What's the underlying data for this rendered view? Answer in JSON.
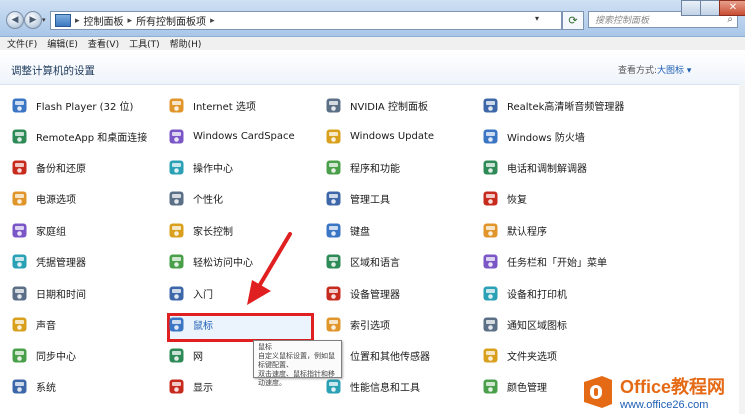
{
  "titlebar": {
    "breadcrumb": [
      "控制面板",
      "所有控制面板项"
    ],
    "search_placeholder": "搜索控制面板",
    "close_glyph": "✕"
  },
  "menubar": {
    "items": [
      "文件(F)",
      "编辑(E)",
      "查看(V)",
      "工具(T)",
      "帮助(H)"
    ]
  },
  "header": {
    "title": "调整计算机的设置",
    "view_label": "查看方式:",
    "view_value": "大图标 ▾"
  },
  "items": {
    "c1": [
      "Flash Player (32 位)",
      "RemoteApp 和桌面连接",
      "备份和还原",
      "电源选项",
      "家庭组",
      "凭据管理器",
      "日期和时间",
      "声音",
      "同步中心",
      "系统"
    ],
    "c2": [
      "Internet 选项",
      "Windows CardSpace",
      "操作中心",
      "个性化",
      "家长控制",
      "轻松访问中心",
      "入门",
      "鼠标",
      "网",
      "显示"
    ],
    "c3": [
      "NVIDIA 控制面板",
      "Windows Update",
      "程序和功能",
      "管理工具",
      "键盘",
      "区域和语言",
      "设备管理器",
      "索引选项",
      "位置和其他传感器",
      "性能信息和工具"
    ],
    "c4": [
      "Realtek高清晰音频管理器",
      "Windows 防火墙",
      "电话和调制解调器",
      "恢复",
      "默认程序",
      "任务栏和「开始」菜单",
      "设备和打印机",
      "通知区域图标",
      "文件夹选项",
      "颜色管理"
    ]
  },
  "tooltip": {
    "line1": "鼠标",
    "line2": "自定义鼠标设置，例如鼠标键配置、",
    "line3": "双击速度、鼠标指针和移动速度。"
  },
  "watermark": {
    "brand": "Office教程网",
    "url": "www.office26.com"
  },
  "colors": {
    "highlight": "#e02020",
    "arrow": "#e02020",
    "watermark_orange": "#e56a16"
  }
}
